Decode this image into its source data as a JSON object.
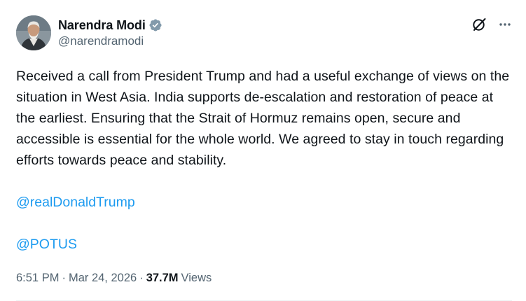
{
  "author": {
    "display_name": "Narendra Modi",
    "handle": "@narendramodi",
    "verified_badge": "verified-badge-icon",
    "verified_color": "#829aab"
  },
  "actions": {
    "grok_icon": "grok-icon",
    "more_icon": "more-icon"
  },
  "tweet": {
    "text": "Received a call from President Trump and had a useful exchange of views on the situation in West Asia. India supports de-escalation and restoration of peace at the earliest. Ensuring that the Strait of Hormuz remains open, secure and accessible is essential for the whole world. We agreed to stay in touch regarding efforts towards peace and stability.",
    "mentions": [
      "@realDonaldTrump",
      "@POTUS"
    ]
  },
  "meta": {
    "time": "6:51 PM",
    "separator_1": "·",
    "date": "Mar 24, 2026",
    "separator_2": "·",
    "views_count": "37.7M",
    "views_label": "Views"
  },
  "colors": {
    "text_primary": "#0f1419",
    "text_secondary": "#536471",
    "link": "#1d9bf0",
    "divider": "#eff3f4"
  }
}
